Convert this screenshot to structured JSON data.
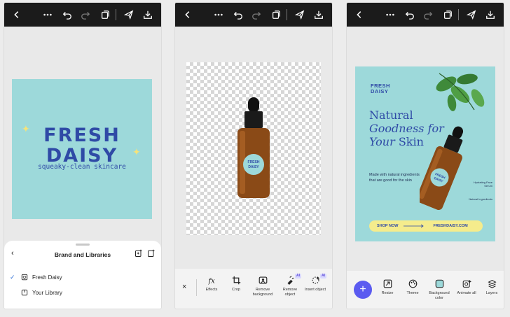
{
  "panel1": {
    "artwork": {
      "brand_line1": "FRESH",
      "brand_line2": "DAISY",
      "tagline": "squeaky-clean skincare"
    },
    "sheet": {
      "title": "Brand and Libraries",
      "items": [
        {
          "label": "Fresh Daisy",
          "selected": true
        },
        {
          "label": "Your Library",
          "selected": false
        }
      ]
    }
  },
  "panel2": {
    "close": "×",
    "tools": [
      {
        "icon": "fx-icon",
        "label": "Effects",
        "ai": false
      },
      {
        "icon": "crop-icon",
        "label": "Crop",
        "ai": false
      },
      {
        "icon": "remove-background-icon",
        "label": "Remove background",
        "ai": false
      },
      {
        "icon": "remove-object-icon",
        "label": "Remove object",
        "ai": true
      },
      {
        "icon": "insert-object-icon",
        "label": "Insert object",
        "ai": true
      }
    ],
    "ai_badge": "AI"
  },
  "panel3": {
    "artwork": {
      "logo_line1": "FRESH",
      "logo_line2": "DAISY",
      "headline_1": "Natural",
      "headline_2": "Goodness for",
      "headline_3a": "Your ",
      "headline_3b": "Skin",
      "body": "Made with natural ingredients that are good for the skin",
      "note1": "Hydrating Face Serum",
      "note2": "Natural Ingredients",
      "shop_label": "SHOP NOW",
      "shop_url": "FRESHDAISY.COM"
    },
    "add_label": "+",
    "tools": [
      {
        "icon": "resize-icon",
        "label": "Resize"
      },
      {
        "icon": "theme-icon",
        "label": "Theme"
      },
      {
        "icon": "background-color-icon",
        "label": "Background color"
      },
      {
        "icon": "animate-all-icon",
        "label": "Animate all"
      },
      {
        "icon": "layers-icon",
        "label": "Layers"
      }
    ]
  },
  "colors": {
    "brand_blue": "#2f4aa6",
    "art_teal": "#9dd9da",
    "accent_purple": "#5b5bf0",
    "shop_yellow": "#f5ec8c",
    "bottle_amber": "#8a4a17"
  }
}
